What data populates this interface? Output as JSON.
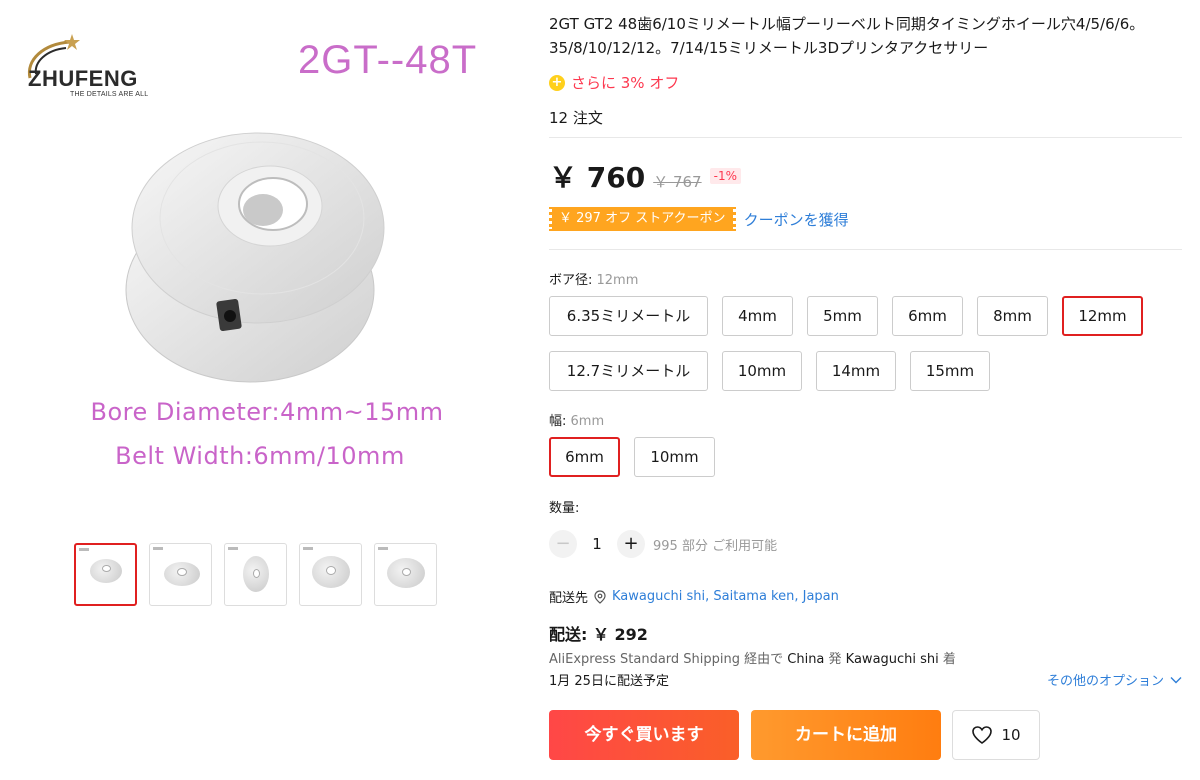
{
  "gallery": {
    "brand": "ZHUFENG",
    "tagline": "THE DETAILS ARE ALL",
    "model": "2GT--48T",
    "spec_bore": "Bore Diameter:4mm~15mm",
    "spec_belt": "Belt Width:6mm/10mm",
    "thumbnail_count": 5,
    "active_thumbnail": 1
  },
  "product": {
    "title": "2GT GT2 48歯6/10ミリメートル幅プーリーベルト同期タイミングホイール穴4/5/6/6。35/8/10/12/12。7/14/15ミリメートル3Dプリンタアクセサリー",
    "discount_icon": "coin-icon",
    "extra_discount": "さらに 3% オフ",
    "orders": "12 注文",
    "price": "￥ 760",
    "original_price": "￥ 767",
    "discount_pct": "-1%",
    "coupon": "￥ 297 オフ ストアクーポン",
    "coupon_link": "クーポンを獲得"
  },
  "options": {
    "bore_label": "ボア径: ",
    "bore_selected": "12mm",
    "bore_values": [
      "6.35ミリメートル",
      "4mm",
      "5mm",
      "6mm",
      "8mm",
      "12mm",
      "12.7ミリメートル",
      "10mm",
      "14mm",
      "15mm"
    ],
    "width_label": "幅: ",
    "width_selected": "6mm",
    "width_values": [
      "6mm",
      "10mm"
    ]
  },
  "quantity": {
    "label": "数量:",
    "value": "1",
    "minus": "−",
    "plus": "+",
    "available": "995 部分 ご利用可能"
  },
  "shipping": {
    "to_label": "配送先",
    "location": "Kawaguchi shi, Saitama ken, Japan",
    "cost": "配送: ￥ 292",
    "method_pre": "AliExpress Standard Shipping 経由で ",
    "origin": "China",
    "method_mid": " 発 ",
    "dest": "Kawaguchi shi",
    "method_post": " 着",
    "delivery": "1月 25日に配送予定",
    "more_options": "その他のオプション"
  },
  "actions": {
    "buy_now": "今すぐ買います",
    "add_to_cart": "カートに追加",
    "wishlist_count": "10"
  },
  "colors": {
    "accent_red": "#fd384f",
    "selected_border": "#e02020",
    "link_blue": "#2e7ed8",
    "coupon_orange": "#ffa51f",
    "spec_purple": "#c964c9"
  }
}
